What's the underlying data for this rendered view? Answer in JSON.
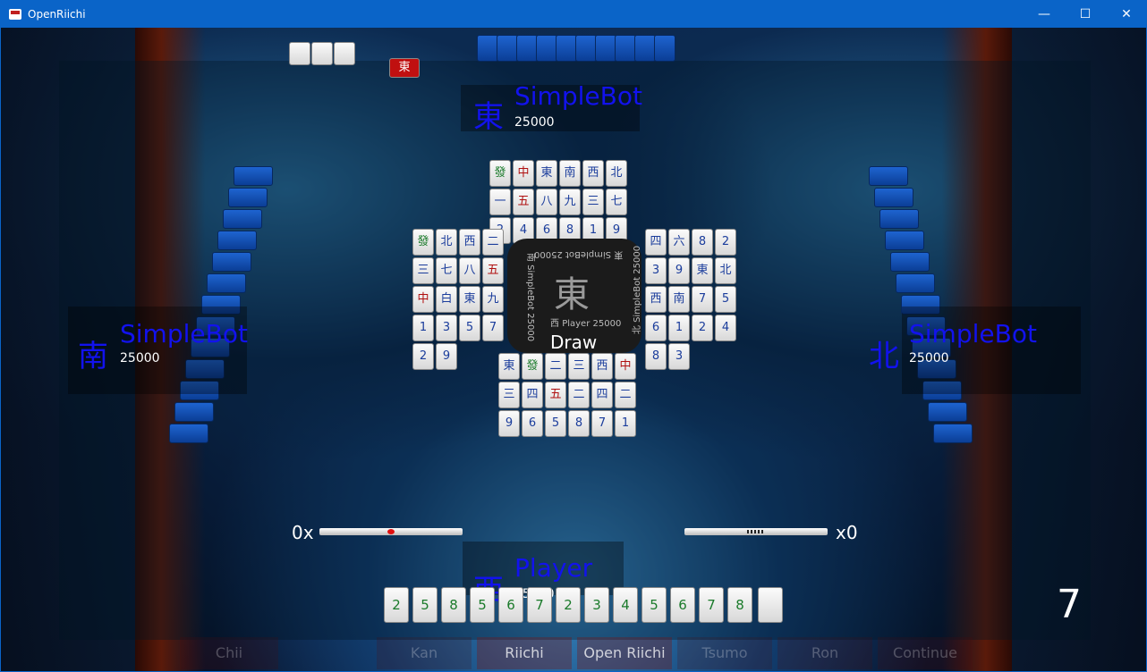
{
  "window": {
    "title": "OpenRiichi",
    "minimize": "—",
    "maximize": "☐",
    "close": "✕"
  },
  "players": {
    "top": {
      "wind": "東",
      "name": "SimpleBot",
      "score": "25000"
    },
    "left": {
      "wind": "南",
      "name": "SimpleBot",
      "score": "25000"
    },
    "right": {
      "wind": "北",
      "name": "SimpleBot",
      "score": "25000"
    },
    "bottom": {
      "wind": "西",
      "name": "Player",
      "score": "25000"
    }
  },
  "center": {
    "round_wind": "東",
    "top_label": "東",
    "top_name": "SimpleBot",
    "top_score": "25000",
    "left_label": "南",
    "left_name": "SimpleBot",
    "left_score": "25000",
    "right_label": "北",
    "right_name": "SimpleBot",
    "right_score": "25000",
    "bottom_label": "西",
    "bottom_name": "Player",
    "bottom_score": "25000",
    "status": "Draw"
  },
  "counters": {
    "left": "0x",
    "right": "x0"
  },
  "round_number": "7",
  "indicator_tile": "東",
  "actions": {
    "chii": "Chii",
    "kan": "Kan",
    "riichi": "Riichi",
    "open_riichi": "Open Riichi",
    "tsumo": "Tsumo",
    "ron": "Ron",
    "continue": "Continue"
  },
  "discards": {
    "top": [
      "發",
      "中",
      "東",
      "南",
      "西",
      "北",
      "一",
      "五",
      "八",
      "九",
      "三",
      "七",
      "2",
      "4",
      "6",
      "8",
      "1",
      "9"
    ],
    "left": [
      "發",
      "北",
      "西",
      "二",
      "三",
      "七",
      "八",
      "五",
      "中",
      "白",
      "東",
      "九",
      "1",
      "3",
      "5",
      "7",
      "2",
      "9"
    ],
    "right": [
      "四",
      "六",
      "8",
      "2",
      "3",
      "9",
      "東",
      "北",
      "西",
      "南",
      "7",
      "5",
      "6",
      "1",
      "2",
      "4",
      "8",
      "3"
    ],
    "bottom": [
      "東",
      "發",
      "二",
      "三",
      "西",
      "中",
      "三",
      "四",
      "五",
      "二",
      "四",
      "二",
      "9",
      "6",
      "5",
      "8",
      "7",
      "1"
    ]
  },
  "hand": [
    "2",
    "5",
    "8",
    "5",
    "6",
    "7",
    "2",
    "3",
    "4",
    "5",
    "6",
    "7",
    "8"
  ],
  "colors": {
    "accent": "#1212ee",
    "titlebar": "#0a64c8",
    "tile_back": "#1e64d0"
  }
}
